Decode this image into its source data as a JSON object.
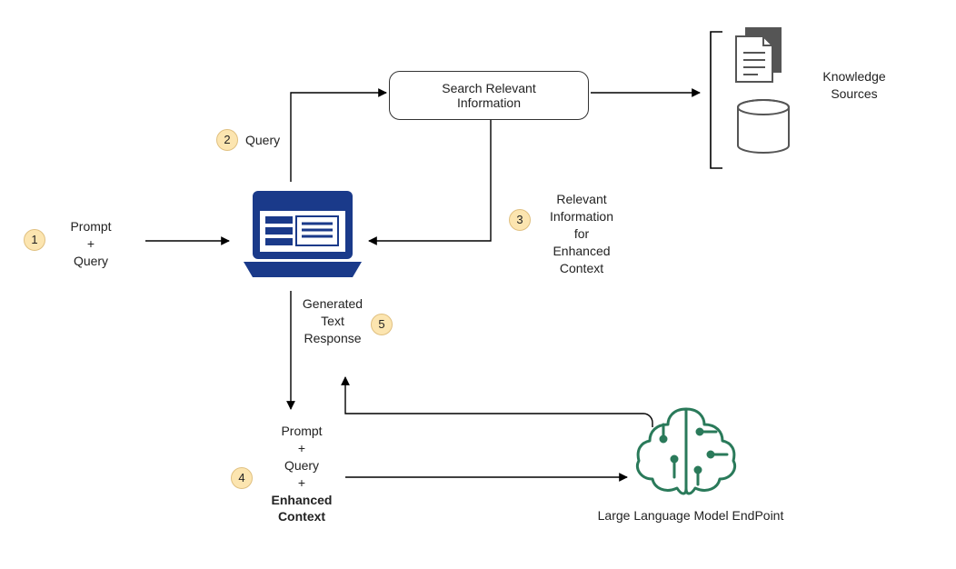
{
  "steps": {
    "s1": {
      "num": "1",
      "line1": "Prompt",
      "line2": "+",
      "line3": "Query"
    },
    "s2": {
      "num": "2",
      "line1": "Query"
    },
    "s3": {
      "num": "3",
      "line1": "Relevant",
      "line2": "Information",
      "line3": "for",
      "line4": "Enhanced",
      "line5": "Context"
    },
    "s4": {
      "num": "4",
      "line1": "Prompt",
      "line2": "+",
      "line3": "Query",
      "line4": "+",
      "line5": "Enhanced",
      "line6": "Context"
    },
    "s5": {
      "num": "5",
      "line1": "Generated",
      "line2": "Text",
      "line3": "Response"
    }
  },
  "nodes": {
    "search": {
      "line1": "Search Relevant",
      "line2": "Information"
    },
    "knowledge": "Knowledge Sources",
    "llm": "Large Language Model EndPoint"
  }
}
